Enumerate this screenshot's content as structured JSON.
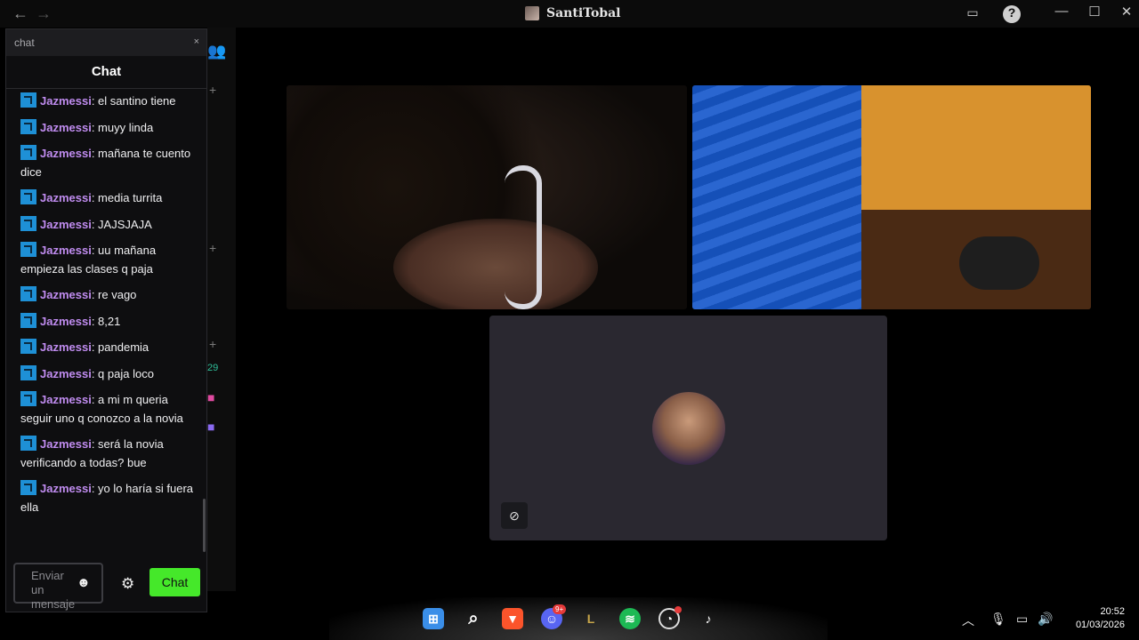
{
  "window": {
    "title": "SantiTobal",
    "back_icon": "arrow-left",
    "forward_icon": "arrow-right",
    "minimize": "—",
    "maximize": "☐",
    "close": "✕"
  },
  "chat": {
    "tab_label": "chat",
    "close_label": "×",
    "title": "Chat",
    "messages": [
      {
        "user": "Jazmessi",
        "text": ": el santino tiene"
      },
      {
        "user": "Jazmessi",
        "text": ": muyy linda"
      },
      {
        "user": "Jazmessi",
        "text": ": mañana te cuento dice"
      },
      {
        "user": "Jazmessi",
        "text": ": media turrita"
      },
      {
        "user": "Jazmessi",
        "text": ": JAJSJAJA"
      },
      {
        "user": "Jazmessi",
        "text": ": uu mañana empieza las clases q paja"
      },
      {
        "user": "Jazmessi",
        "text": ": re vago"
      },
      {
        "user": "Jazmessi",
        "text": ": 8,21"
      },
      {
        "user": "Jazmessi",
        "text": ": pandemia"
      },
      {
        "user": "Jazmessi",
        "text": ": q paja loco"
      },
      {
        "user": "Jazmessi",
        "text": ": a mi m queria seguir uno q conozco a la novia"
      },
      {
        "user": "Jazmessi",
        "text": ": será la novia verificando a todas? bue"
      },
      {
        "user": "Jazmessi",
        "text": ": yo lo haría si fuera ella"
      }
    ],
    "input_placeholder": "Enviar un mensaje",
    "send_label": "Chat"
  },
  "sidebar": {
    "count_label": "29"
  },
  "video": {
    "tile3_cam_off_icon": "camera-off-icon"
  },
  "taskbar": {
    "discord_badge": "9+",
    "clock_time": "20:52",
    "clock_date": "01/03/2026"
  },
  "colors": {
    "username": "#c08cf0",
    "send_button": "#45e82a",
    "badge": "#1e90d6"
  }
}
